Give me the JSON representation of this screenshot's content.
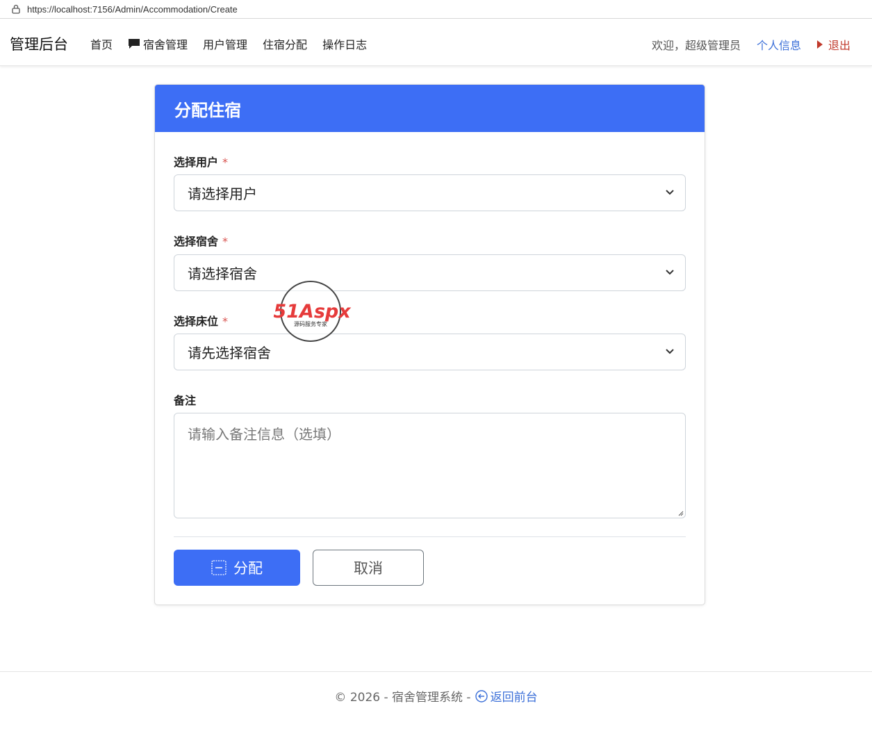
{
  "browser": {
    "url": "https://localhost:7156/Admin/Accommodation/Create",
    "lock_icon": "lock-icon"
  },
  "navbar": {
    "brand": "管理后台",
    "items": [
      {
        "label": "首页"
      },
      {
        "label": "宿舍管理",
        "icon": "chat-bubble-icon"
      },
      {
        "label": "用户管理"
      },
      {
        "label": "住宿分配"
      },
      {
        "label": "操作日志"
      }
    ],
    "welcome": "欢迎，超级管理员",
    "profile": "个人信息",
    "logout": "退出",
    "colors": {
      "link": "#3b6fd8",
      "logout": "#c0392b"
    }
  },
  "form": {
    "title": "分配住宿",
    "header_color": "#3d6ef5",
    "user": {
      "label": "选择用户",
      "required": "*",
      "value": "请选择用户"
    },
    "dorm": {
      "label": "选择宿舍",
      "required": "*",
      "value": "请选择宿舍"
    },
    "bed": {
      "label": "选择床位",
      "required": "*",
      "value": "请先选择宿舍"
    },
    "notes": {
      "label": "备注",
      "placeholder": "请输入备注信息（选填）"
    },
    "submit": "分配",
    "cancel": "取消"
  },
  "watermark": {
    "brand": "51Aspx",
    "tagline": "源码服务专家"
  },
  "footer": {
    "text": "© 2026 - 宿舍管理系统 -",
    "back": "返回前台"
  }
}
